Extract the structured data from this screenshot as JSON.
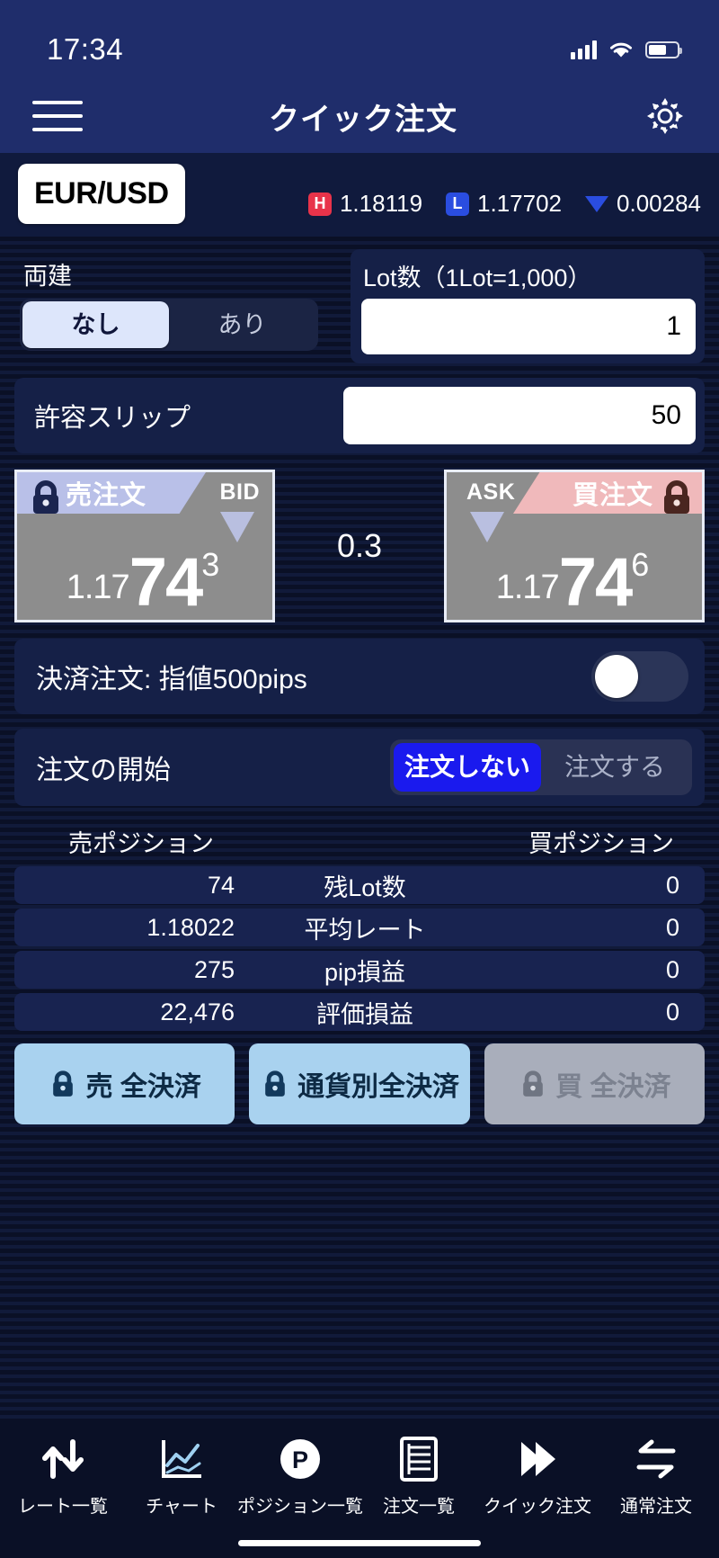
{
  "status": {
    "time": "17:34",
    "signal_icon": "cellular-bars-icon",
    "wifi_icon": "wifi-icon",
    "battery_icon": "battery-icon"
  },
  "nav": {
    "menu_icon": "hamburger-menu-icon",
    "title": "クイック注文",
    "settings_icon": "gear-icon"
  },
  "symbol": {
    "pair": "EUR/USD",
    "high_tag": "H",
    "high_value": "1.18119",
    "low_tag": "L",
    "low_value": "1.17702",
    "change_icon": "triangle-down-icon",
    "change_value": "0.00284"
  },
  "hedge": {
    "label": "両建",
    "options": [
      "なし",
      "あり"
    ],
    "selected": "なし"
  },
  "lot": {
    "label": "Lot数（1Lot=1,000）",
    "value": "1",
    "placeholder": "1"
  },
  "slippage": {
    "label": "許容スリップ",
    "value": "50",
    "placeholder": "50"
  },
  "rates": {
    "sell": {
      "banner": "売注文",
      "side_label": "BID",
      "lock_icon": "lock-icon",
      "arrow_icon": "triangle-down-icon",
      "price_prefix": "1.17",
      "price_big": "74",
      "price_sup": "3"
    },
    "spread": "0.3",
    "buy": {
      "banner": "買注文",
      "side_label": "ASK",
      "lock_icon": "lock-icon",
      "arrow_icon": "triangle-down-icon",
      "price_prefix": "1.17",
      "price_big": "74",
      "price_sup": "6"
    }
  },
  "settle": {
    "label": "決済注文: 指値500pips",
    "toggle_state": "off"
  },
  "order_start": {
    "label": "注文の開始",
    "options": [
      "注文しない",
      "注文する"
    ],
    "selected": "注文しない"
  },
  "positions": {
    "header_sell": "売ポジション",
    "header_buy": "買ポジション",
    "rows": [
      {
        "sell": "74",
        "label": "残Lot数",
        "buy": "0"
      },
      {
        "sell": "1.18022",
        "label": "平均レート",
        "buy": "0"
      },
      {
        "sell": "275",
        "label": "pip損益",
        "buy": "0"
      },
      {
        "sell": "22,476",
        "label": "評価損益",
        "buy": "0"
      }
    ]
  },
  "close_all": {
    "sell": "売 全決済",
    "currency": "通貨別全決済",
    "buy": "買 全決済",
    "lock_icon": "lock-icon"
  },
  "tabbar": {
    "items": [
      {
        "label": "レート一覧",
        "icon": "up-down-arrows-icon"
      },
      {
        "label": "チャート",
        "icon": "chart-icon"
      },
      {
        "label": "ポジション一覧",
        "icon": "p-circle-icon"
      },
      {
        "label": "注文一覧",
        "icon": "list-document-icon"
      },
      {
        "label": "クイック注文",
        "icon": "double-chevron-right-icon"
      },
      {
        "label": "通常注文",
        "icon": "swap-arrows-icon"
      }
    ],
    "active": "クイック注文"
  },
  "colors": {
    "nav_blue": "#1f2d6b",
    "bg_dark": "#0a1026",
    "card": "#152047",
    "accent_blue": "#1a1aee",
    "high_red": "#e8334a",
    "low_blue": "#2a4de0",
    "sell_banner": "#b9c0e8",
    "buy_banner": "#f0b9bb",
    "rate_body": "#8d8d8d",
    "close_btn": "#a9d2ef",
    "close_btn_disabled": "#a9aebb"
  }
}
